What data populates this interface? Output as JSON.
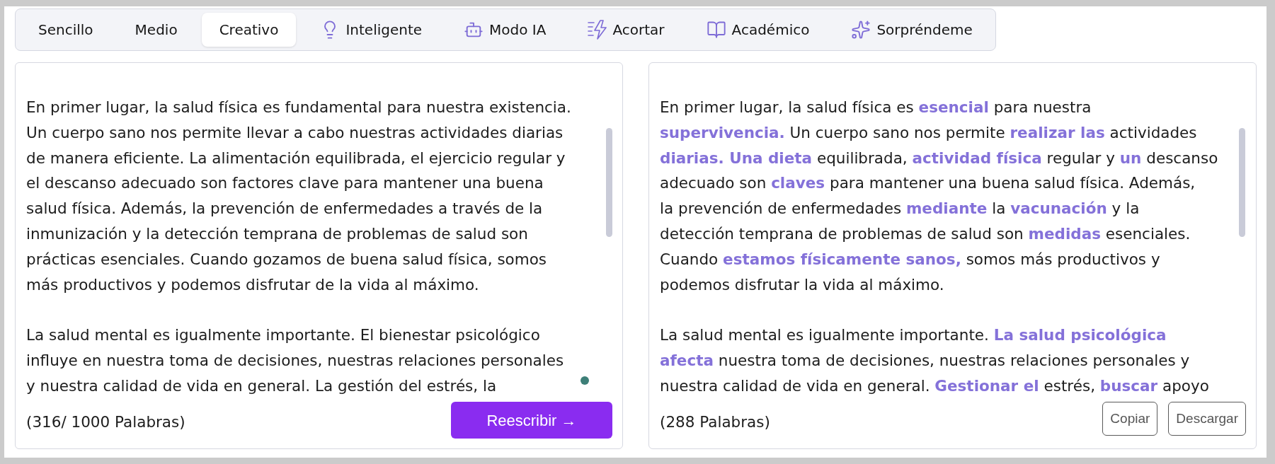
{
  "tabs": [
    {
      "label": "Sencillo",
      "kind": "plain",
      "selected": false
    },
    {
      "label": "Medio",
      "kind": "plain",
      "selected": false
    },
    {
      "label": "Creativo",
      "kind": "plain",
      "selected": true
    },
    {
      "label": "Inteligente",
      "kind": "icon",
      "selected": false
    },
    {
      "label": "Modo IA",
      "kind": "icon",
      "selected": false
    },
    {
      "label": "Acortar",
      "kind": "icon",
      "selected": false
    },
    {
      "label": "Académico",
      "kind": "icon",
      "selected": false
    },
    {
      "label": "Sorpréndeme",
      "kind": "icon",
      "selected": false
    }
  ],
  "input_panel": {
    "paragraphs": [
      "En primer lugar, la salud física es fundamental para nuestra existencia.\nUn cuerpo sano nos permite llevar a cabo nuestras actividades diarias\nde manera eficiente. La alimentación equilibrada, el ejercicio regular y\nel descanso adecuado son factores clave para mantener una buena\nsalud física. Además, la prevención de enfermedades a través de la\ninmunización y la detección temprana de problemas de salud son\nprácticas esenciales. Cuando gozamos de buena salud física, somos\nmás productivos y podemos disfrutar de la vida al máximo.",
      "La salud mental es igualmente importante. El bienestar psicológico\ninfluye en nuestra toma de decisiones, nuestras relaciones personales\ny nuestra calidad de vida en general. La gestión del estrés, la"
    ],
    "word_count": "(316/ 1000 Palabras)",
    "submit_button": "Reescribir →"
  },
  "output_panel": {
    "paragraphs": [
      "En primer lugar, la salud física es **esencial** para nuestra\n**supervivencia.** Un cuerpo sano nos permite **realizar las** actividades\n**diarias. Una dieta** equilibrada, **actividad física** regular y **un** descanso\nadecuado son **claves** para mantener una buena salud física. Además,\nla prevención de enfermedades **mediante** la **vacunación** y la\ndetección temprana de problemas de salud son **medidas** esenciales.\nCuando **estamos físicamente sanos,** somos más productivos y\npodemos disfrutar la vida al máximo.",
      "La salud mental es igualmente importante. **La salud psicológica**\n**afecta** nuestra toma de decisiones, nuestras relaciones personales y\nnuestra calidad de vida en general. **Gestionar el** estrés, **buscar** apoyo"
    ],
    "word_count": "(288 Palabras)",
    "buttons": [
      "Copiar",
      "Descargar"
    ]
  }
}
